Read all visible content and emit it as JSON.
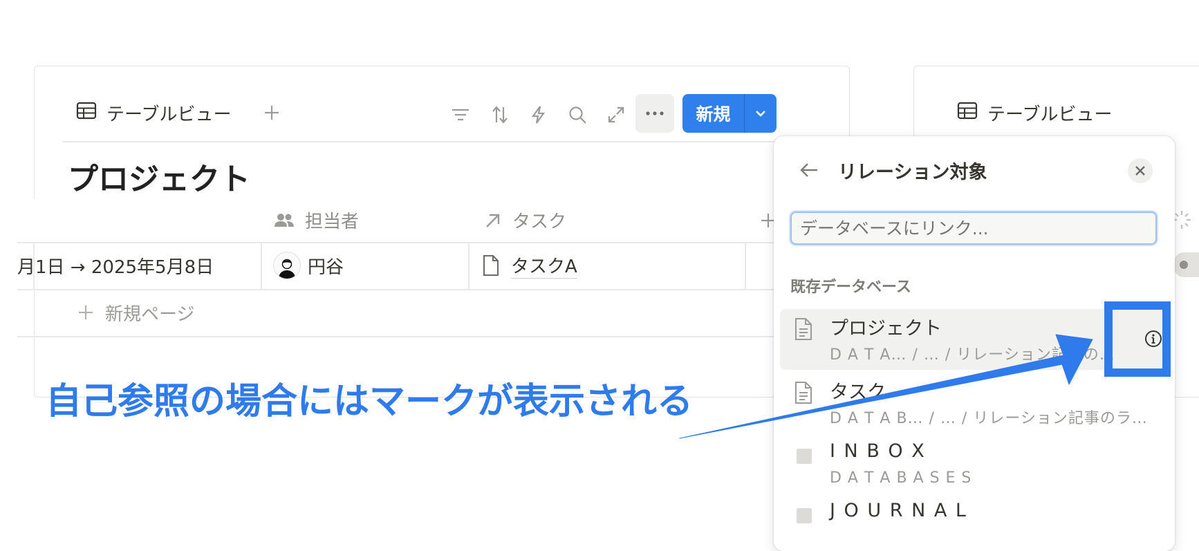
{
  "left_view": {
    "view_tab_label": "テーブルビュー",
    "new_button_label": "新規",
    "db_title": "プロジェクト",
    "columns": {
      "assignee": "担当者",
      "task": "タスク"
    },
    "row": {
      "date": "月1日 → 2025年5月8日",
      "assignee": "円谷",
      "task": "タスクA"
    },
    "new_page_label": "新規ページ"
  },
  "right_view": {
    "view_tab_label": "テーブルビュー"
  },
  "relation_popup": {
    "title": "リレーション対象",
    "search_placeholder": "データベースにリンク...",
    "section_label": "既存データベース",
    "items": [
      {
        "title": "プロジェクト",
        "subtitle": "D A T A…  / … / リレーション記事の…"
      },
      {
        "title": "タスク",
        "subtitle": "D A T A B…  / … / リレーション記事のラ…"
      },
      {
        "title": "I N B O X",
        "subtitle": "D A T A B A S E S"
      },
      {
        "title": "J O U R N A L",
        "subtitle": ""
      }
    ]
  },
  "annotation": {
    "text": "自己参照の場合にはマークが表示される",
    "color": "#2f7bec"
  },
  "colors": {
    "accent": "#2f80ed",
    "highlight": "#2f7bec"
  }
}
